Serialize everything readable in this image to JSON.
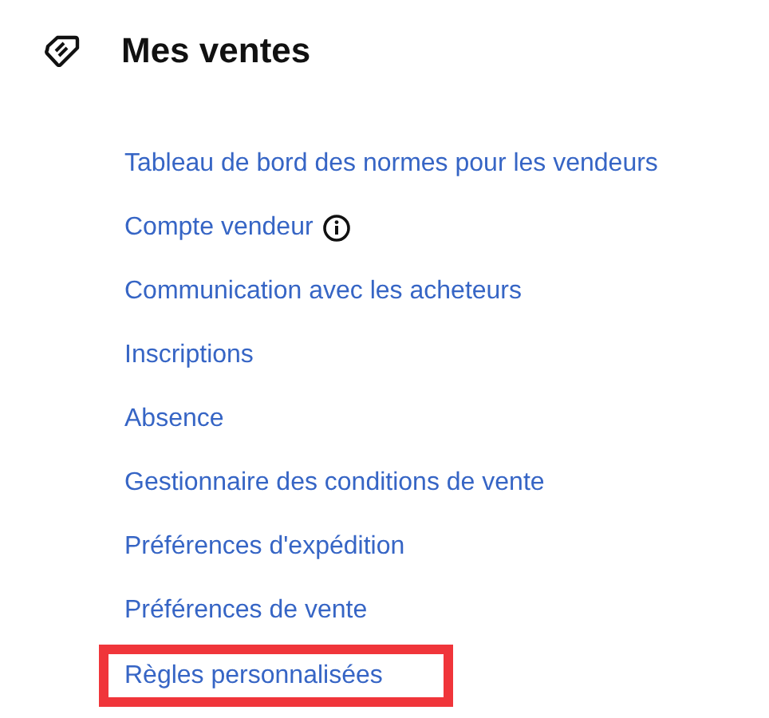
{
  "title": "Mes ventes",
  "links": [
    {
      "label": "Tableau de bord des normes pour les vendeurs",
      "info": false,
      "highlighted": false
    },
    {
      "label": "Compte vendeur",
      "info": true,
      "highlighted": false
    },
    {
      "label": "Communication avec les acheteurs",
      "info": false,
      "highlighted": false
    },
    {
      "label": "Inscriptions",
      "info": false,
      "highlighted": false
    },
    {
      "label": "Absence",
      "info": false,
      "highlighted": false
    },
    {
      "label": "Gestionnaire des conditions de vente",
      "info": false,
      "highlighted": false
    },
    {
      "label": "Préférences d'expédition",
      "info": false,
      "highlighted": false
    },
    {
      "label": "Préférences de vente",
      "info": false,
      "highlighted": false
    },
    {
      "label": "Règles personnalisées",
      "info": false,
      "highlighted": true
    }
  ]
}
